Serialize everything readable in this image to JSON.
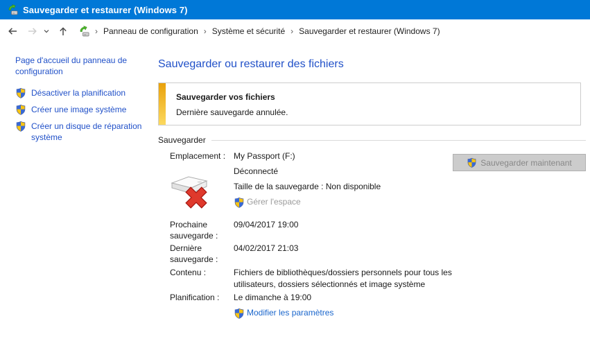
{
  "window": {
    "title": "Sauvegarder et restaurer (Windows 7)"
  },
  "navbar": {
    "separator": "›",
    "breadcrumb": [
      "Panneau de configuration",
      "Système et sécurité",
      "Sauvegarder et restaurer (Windows 7)"
    ]
  },
  "sidebar": {
    "home": "Page d'accueil du panneau de configuration",
    "tasks": [
      "Désactiver la planification",
      "Créer une image système",
      "Créer un disque de réparation système"
    ]
  },
  "main": {
    "heading": "Sauvegarder ou restaurer des fichiers",
    "notice": {
      "title": "Sauvegarder vos fichiers",
      "message": "Dernière sauvegarde annulée."
    },
    "section_title": "Sauvegarder",
    "button": {
      "label": "Sauvegarder maintenant",
      "state": "disabled"
    },
    "rows": {
      "location": {
        "label": "Emplacement :",
        "drive_name": "My Passport (F:)",
        "status": "Déconnecté",
        "size": "Taille de la sauvegarde : Non disponible",
        "manage_space_link": "Gérer l'espace"
      },
      "next_backup": {
        "label": "Prochaine sauvegarde :",
        "value": "09/04/2017 19:00"
      },
      "last_backup": {
        "label": "Dernière sauvegarde :",
        "value": "04/02/2017 21:03"
      },
      "content": {
        "label": "Contenu :",
        "value": "Fichiers de bibliothèques/dossiers personnels pour tous les utilisateurs, dossiers sélectionnés et image système"
      },
      "schedule": {
        "label": "Planification :",
        "value": "Le dimanche à 19:00",
        "modify_link": "Modifier les paramètres"
      }
    }
  },
  "colors": {
    "titlebar": "#0078d7",
    "heading_blue": "#2050c8",
    "link_blue": "#1a66cc",
    "disabled_link_gray": "#9b9b9b",
    "disabled_button_bg": "#cccccc",
    "notice_bar_top": "#e9a10b",
    "notice_bar_bottom": "#fcd95f"
  },
  "icons": {
    "backup-app-icon": "drive with green restore arrow",
    "uac-shield-icon": "blue and yellow security shield",
    "disconnected-drive-icon": "external drive with red X",
    "back-icon": "left arrow",
    "forward-icon": "right arrow (disabled)",
    "up-icon": "up arrow",
    "chevron-down-icon": "small down chevron",
    "breadcrumb-separator": "›"
  }
}
